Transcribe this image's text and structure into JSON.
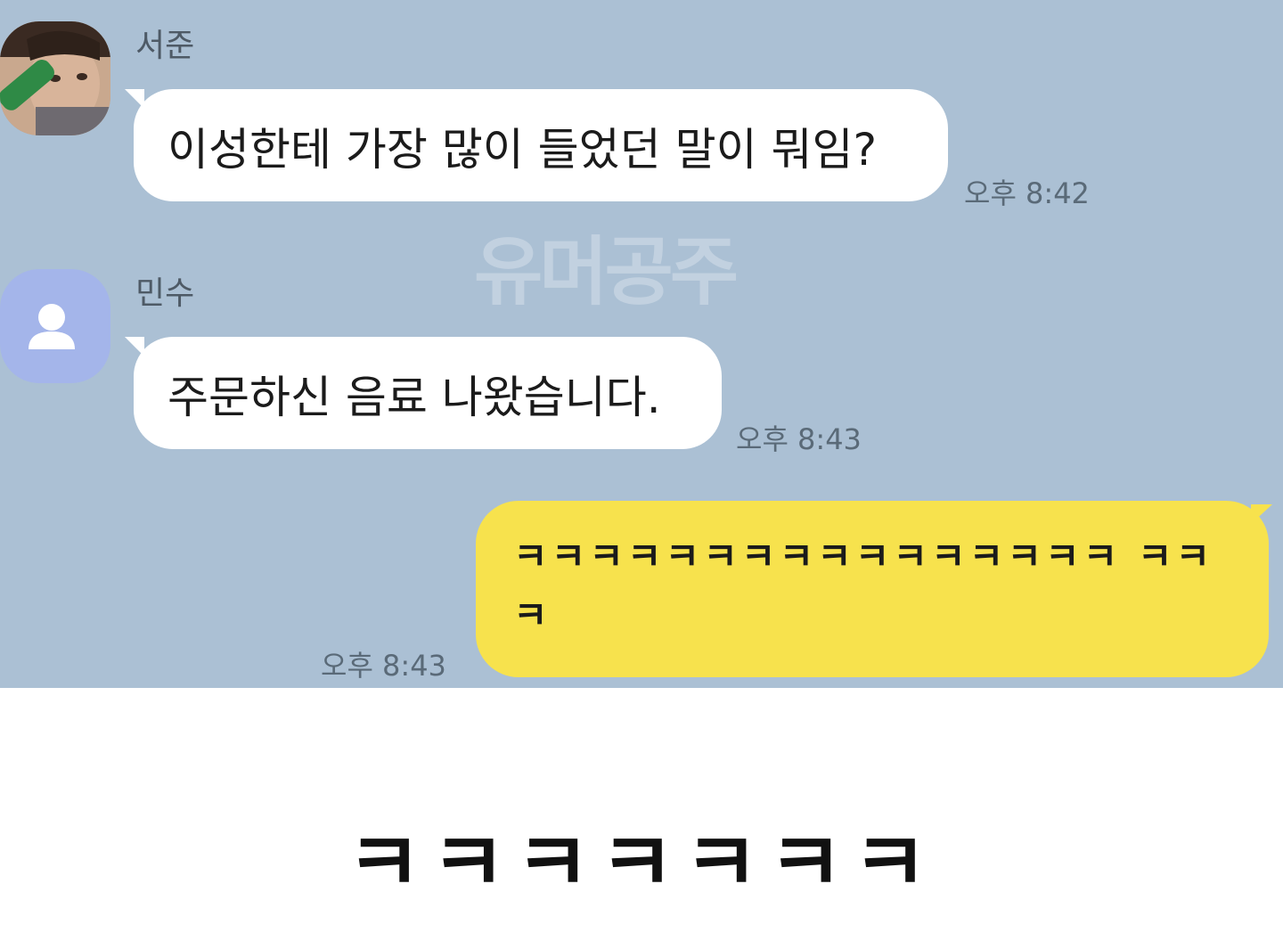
{
  "watermark": "유머공주",
  "messages": [
    {
      "sender": "서준",
      "text": "이성한테 가장 많이 들었던 말이 뭐임?",
      "time": "오후 8:42",
      "avatar": "profile-photo"
    },
    {
      "sender": "민수",
      "text": "주문하신 음료 나왔습니다.",
      "time": "오후 8:43",
      "avatar": "default-person-icon"
    },
    {
      "sender": "",
      "text": "ㅋㅋㅋㅋㅋㅋㅋㅋㅋㅋㅋㅋㅋㅋㅋㅋ ㅋㅋㅋ",
      "time": "오후 8:43"
    }
  ],
  "caption": "ㅋㅋㅋㅋㅋㅋㅋ",
  "colors": {
    "chat_background": "#abc0d4",
    "incoming_bubble": "#ffffff",
    "outgoing_bubble": "#f7e24d",
    "default_avatar": "#a4b5ea"
  }
}
